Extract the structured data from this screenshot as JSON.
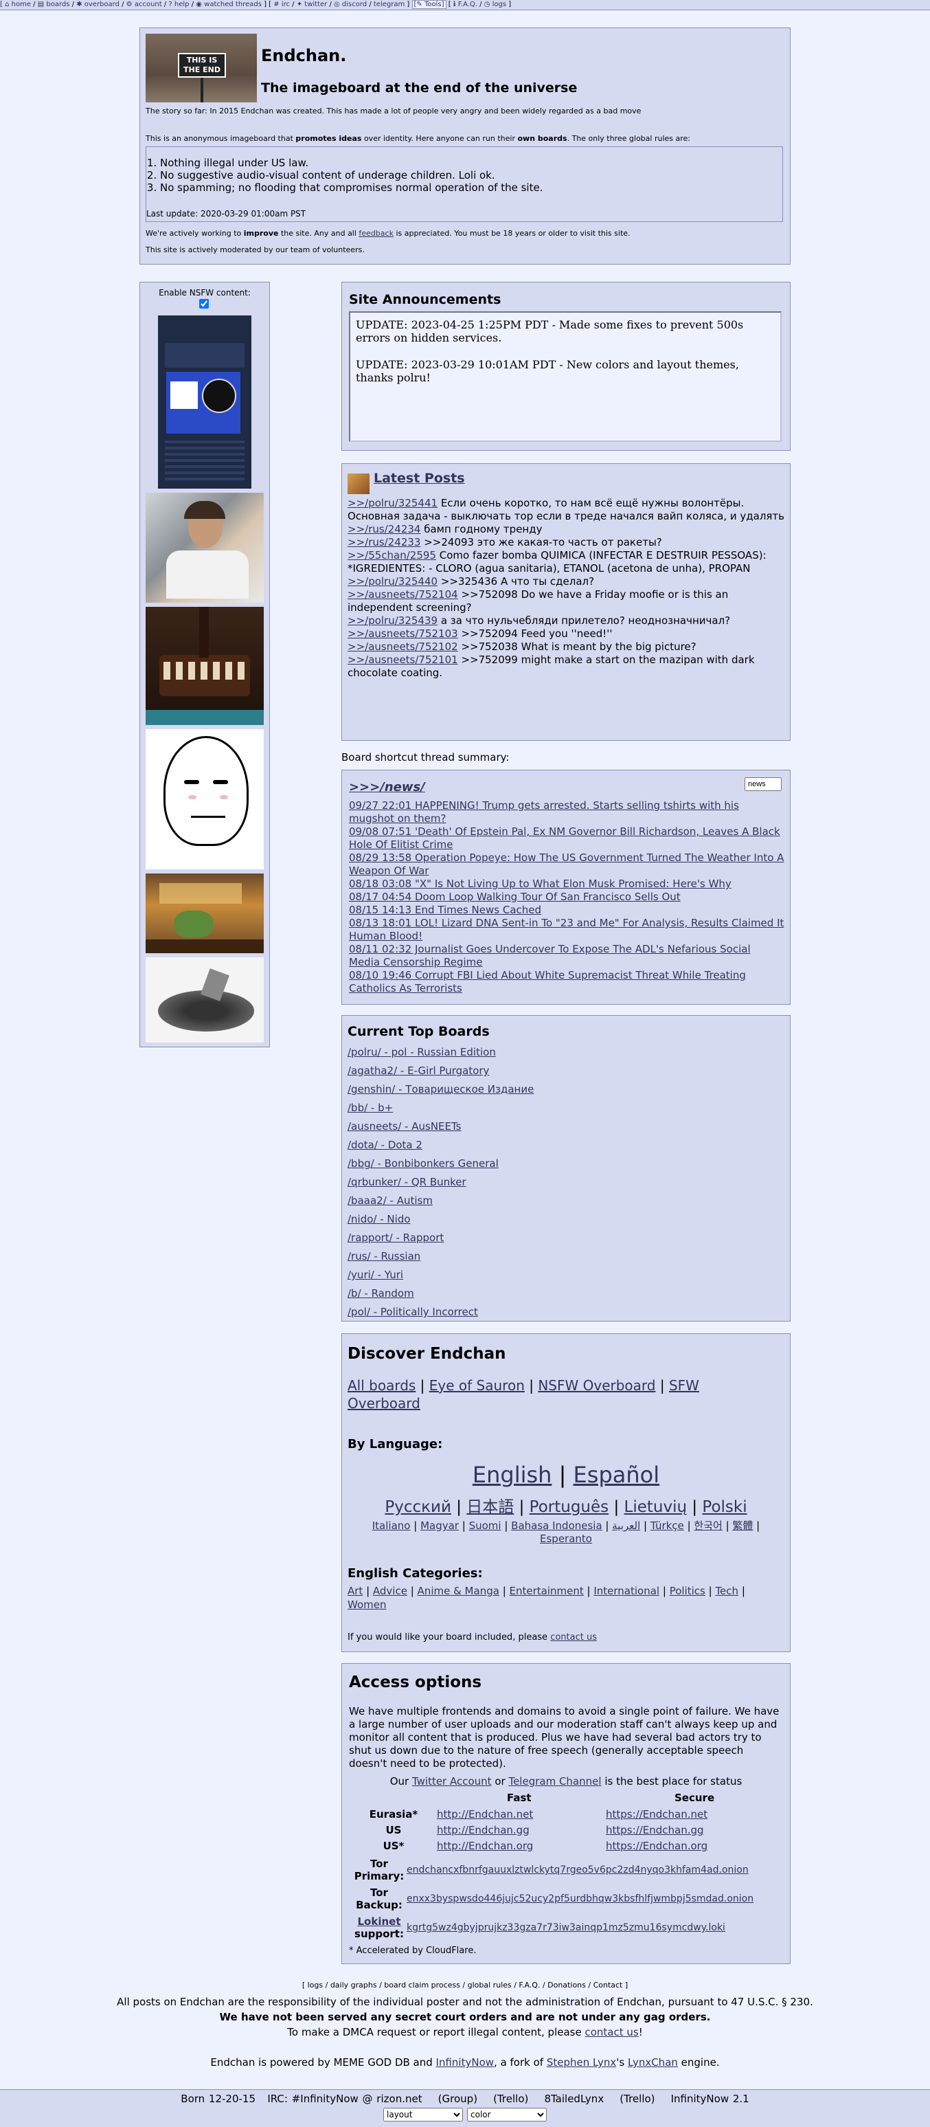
{
  "topbar": {
    "items": [
      "home",
      "boards",
      "overboard",
      "account",
      "help",
      "watched threads",
      "irc",
      "twitter",
      "discord",
      "telegram",
      "Tools",
      "F.A.Q.",
      "logs"
    ]
  },
  "header": {
    "logo_text": "THIS IS THE END",
    "title": "Endchan.",
    "subtitle": "The imageboard at the end of the universe",
    "story": "The story so far: In 2015 Endchan was created. This has made a lot of people very angry and been widely regarded as a bad move",
    "intro_a": "This is an anonymous imageboard that ",
    "intro_b": "promotes ideas",
    "intro_c": " over identity. Here anyone can run their ",
    "intro_d": "own boards",
    "intro_e": ". The only three global rules are:",
    "rules": [
      "Nothing illegal under US law.",
      "No suggestive audio-visual content of underage children. Loli ok.",
      "No spamming; no flooding that compromises normal operation of the site."
    ],
    "last_update": "Last update: 2020-03-29 01:00am PST",
    "improve_a": "We're actively working to ",
    "improve_b": "improve",
    "improve_c": " the site. Any and all ",
    "improve_d": "feedback",
    "improve_e": " is appreciated. You must be 18 years or older to visit this site.",
    "moderated": "This site is actively moderated by our team of volunteers."
  },
  "nsfw": {
    "label": "Enable NSFW content:"
  },
  "announcements": {
    "title": "Site Announcements",
    "items": [
      "UPDATE: 2023-04-25 1:25PM PDT - Made some fixes to prevent 500s errors on hidden services.",
      "UPDATE: 2023-03-29 10:01AM PDT - New colors and layout themes, thanks polru!"
    ]
  },
  "latest": {
    "title": "Latest Posts",
    "posts": [
      {
        "link": ">>/polru/325441",
        "text": " Если очень коротко, то нам всё ещё нужны волонтёры. Основная задача - выключать тор если в треде начался вайп коляса, и удалять"
      },
      {
        "link": ">>/rus/24234",
        "text": " бамп годному тренду"
      },
      {
        "link": ">>/rus/24233",
        "text": " >>24093 это же какая-то часть от ракеты?"
      },
      {
        "link": ">>/55chan/2595",
        "text": " Como fazer bomba QUIMICA (INFECTAR E DESTRUIR PESSOAS): *IGREDIENTES: - CLORO (agua sanitaria), ETANOL (acetona de unha), PROPAN"
      },
      {
        "link": ">>/polru/325440",
        "text": " >>325436 А что ты сделал?"
      },
      {
        "link": ">>/ausneets/752104",
        "text": " >>752098 Do we have a Friday moofie or is this an independent screening?"
      },
      {
        "link": ">>/polru/325439",
        "text": " а за что нульчебляди прилетело? неоднозначничал?"
      },
      {
        "link": ">>/ausneets/752103",
        "text": " >>752094 Feed you ''need!''"
      },
      {
        "link": ">>/ausneets/752102",
        "text": " >>752038 What is meant by the big picture?"
      },
      {
        "link": ">>/ausneets/752101",
        "text": " >>752099 might make a start on the mazipan with dark chocolate coating."
      }
    ]
  },
  "shortcut": {
    "label": "Board shortcut thread summary:",
    "board": ">>>/news/",
    "input_value": "news",
    "threads": [
      "09/27 22:01 HAPPENING! Trump gets arrested. Starts selling tshirts with his mugshot on them?",
      "09/08 07:51 'Death' Of Epstein Pal, Ex NM Governor Bill Richardson, Leaves A Black Hole Of Elitist Crime",
      "08/29 13:58 Operation Popeye: How The US Government Turned The Weather Into A Weapon Of War",
      "08/18 03:08 \"X\" Is Not Living Up to What Elon Musk Promised: Here's Why",
      "08/17 04:54 Doom Loop Walking Tour Of San Francisco Sells Out",
      "08/15 14:13 End Times News Cached",
      "08/13 18:01 LOL! Lizard DNA Sent-in To \"23 and Me\" For Analysis, Results Claimed It Human Blood!",
      "08/11 02:32 Journalist Goes Undercover To Expose The ADL's Nefarious Social Media Censorship Regime",
      "08/10 19:46 Corrupt FBI Lied About White Supremacist Threat While Treating Catholics As Terrorists"
    ]
  },
  "topboards": {
    "title": "Current Top Boards",
    "items": [
      "/polru/ - pol - Russian Edition",
      "/agatha2/ - E-Girl Purgatory",
      "/genshin/ - Товарищеское Издание",
      "/bb/ - b+",
      "/ausneets/ - AusNEETs",
      "/dota/ - Dota 2",
      "/bbg/ - Bonbibonkers General",
      "/qrbunker/ - QR Bunker",
      "/baaa2/ - Autism",
      "/nido/ - Nido",
      "/rapport/ - Rapport",
      "/rus/ - Russian",
      "/yuri/ - Yuri",
      "/b/ - Random",
      "/pol/ - Politically Incorrect"
    ]
  },
  "discover": {
    "title": "Discover Endchan",
    "links": [
      "All boards",
      "Eye of Sauron",
      "NSFW Overboard",
      "SFW Overboard"
    ],
    "by_language": "By Language:",
    "lang_big": [
      "English",
      "Español"
    ],
    "lang_mid": [
      "Русский",
      "日本語",
      "Português",
      "Lietuvių",
      "Polski"
    ],
    "lang_small": [
      "Italiano",
      "Magyar",
      "Suomi",
      "Bahasa Indonesia",
      "العربية",
      "Türkçe",
      "한국어",
      "繁體",
      "Esperanto"
    ],
    "english_categories": "English Categories:",
    "categories": [
      "Art",
      "Advice",
      "Anime & Manga",
      "Entertainment",
      "International",
      "Politics",
      "Tech",
      "Women"
    ],
    "include_a": "If you would like your board included, please ",
    "include_b": "contact us"
  },
  "access": {
    "title": "Access options",
    "desc": "We have multiple frontends and domains to avoid a single point of failure. We have a large number of user uploads and our moderation staff can't always keep up and monitor all content that is produced. Plus we have had several bad actors try to shut us down due to the nature of free speech (generally acceptable speech doesn't need to be protected).",
    "status_a": "Our ",
    "status_b": "Twitter Account",
    "status_c": " or ",
    "status_d": "Telegram Channel",
    "status_e": " is the best place for status",
    "col_fast": "Fast",
    "col_secure": "Secure",
    "rows": [
      {
        "label": "Eurasia*",
        "fast": "http://Endchan.net",
        "secure": "https://Endchan.net"
      },
      {
        "label": "US",
        "fast": "http://Endchan.gg",
        "secure": "https://Endchan.gg"
      },
      {
        "label": "US*",
        "fast": "http://Endchan.org",
        "secure": "https://Endchan.org"
      }
    ],
    "tor_primary_label": "Tor Primary:",
    "tor_primary": "endchancxfbnrfgauuxlztwlckytq7rgeo5v6pc2zd4nyqo3khfam4ad.onion",
    "tor_backup_label": "Tor Backup:",
    "tor_backup": "enxx3byspwsdo446jujc52ucy2pf5urdbhqw3kbsfhlfjwmbpj5smdad.onion",
    "lokinet_a": "Lokinet",
    "lokinet_b": " support:",
    "lokinet": "kgrtg5wz4gbyjprujkz33gza7r73iw3ainqp1mz5zmu16symcdwy.loki",
    "accel": "* Accelerated by CloudFlare."
  },
  "footer": {
    "links": "[ logs / daily graphs / board claim process / global rules / F.A.Q. / Donations / Contact ]",
    "line1": "All posts on Endchan are the responsibility of the individual poster and not the administration of Endchan, pursuant to 47 U.S.C. § 230.",
    "line2": "We have not been served any secret court orders and are not under any gag orders.",
    "line3a": "To make a DMCA request or report illegal content, please ",
    "line3b": "contact us",
    "line3c": "!",
    "powered_a": "Endchan is powered by MEME GOD DB and ",
    "powered_b": "InfinityNow",
    "powered_c": ", a fork of ",
    "powered_d": "Stephen Lynx",
    "powered_e": "'s ",
    "powered_f": "LynxChan",
    "powered_g": " engine."
  },
  "bottombar": {
    "born": "Born 12-20-15",
    "irc": "IRC: #InfinityNow @ rizon.net",
    "group": "(Group)",
    "trello1": "(Trello)",
    "tailed": "8TailedLynx",
    "trello2": "(Trello)",
    "version": "InfinityNow 2.1",
    "layout_select": "layout",
    "color_select": "color"
  }
}
